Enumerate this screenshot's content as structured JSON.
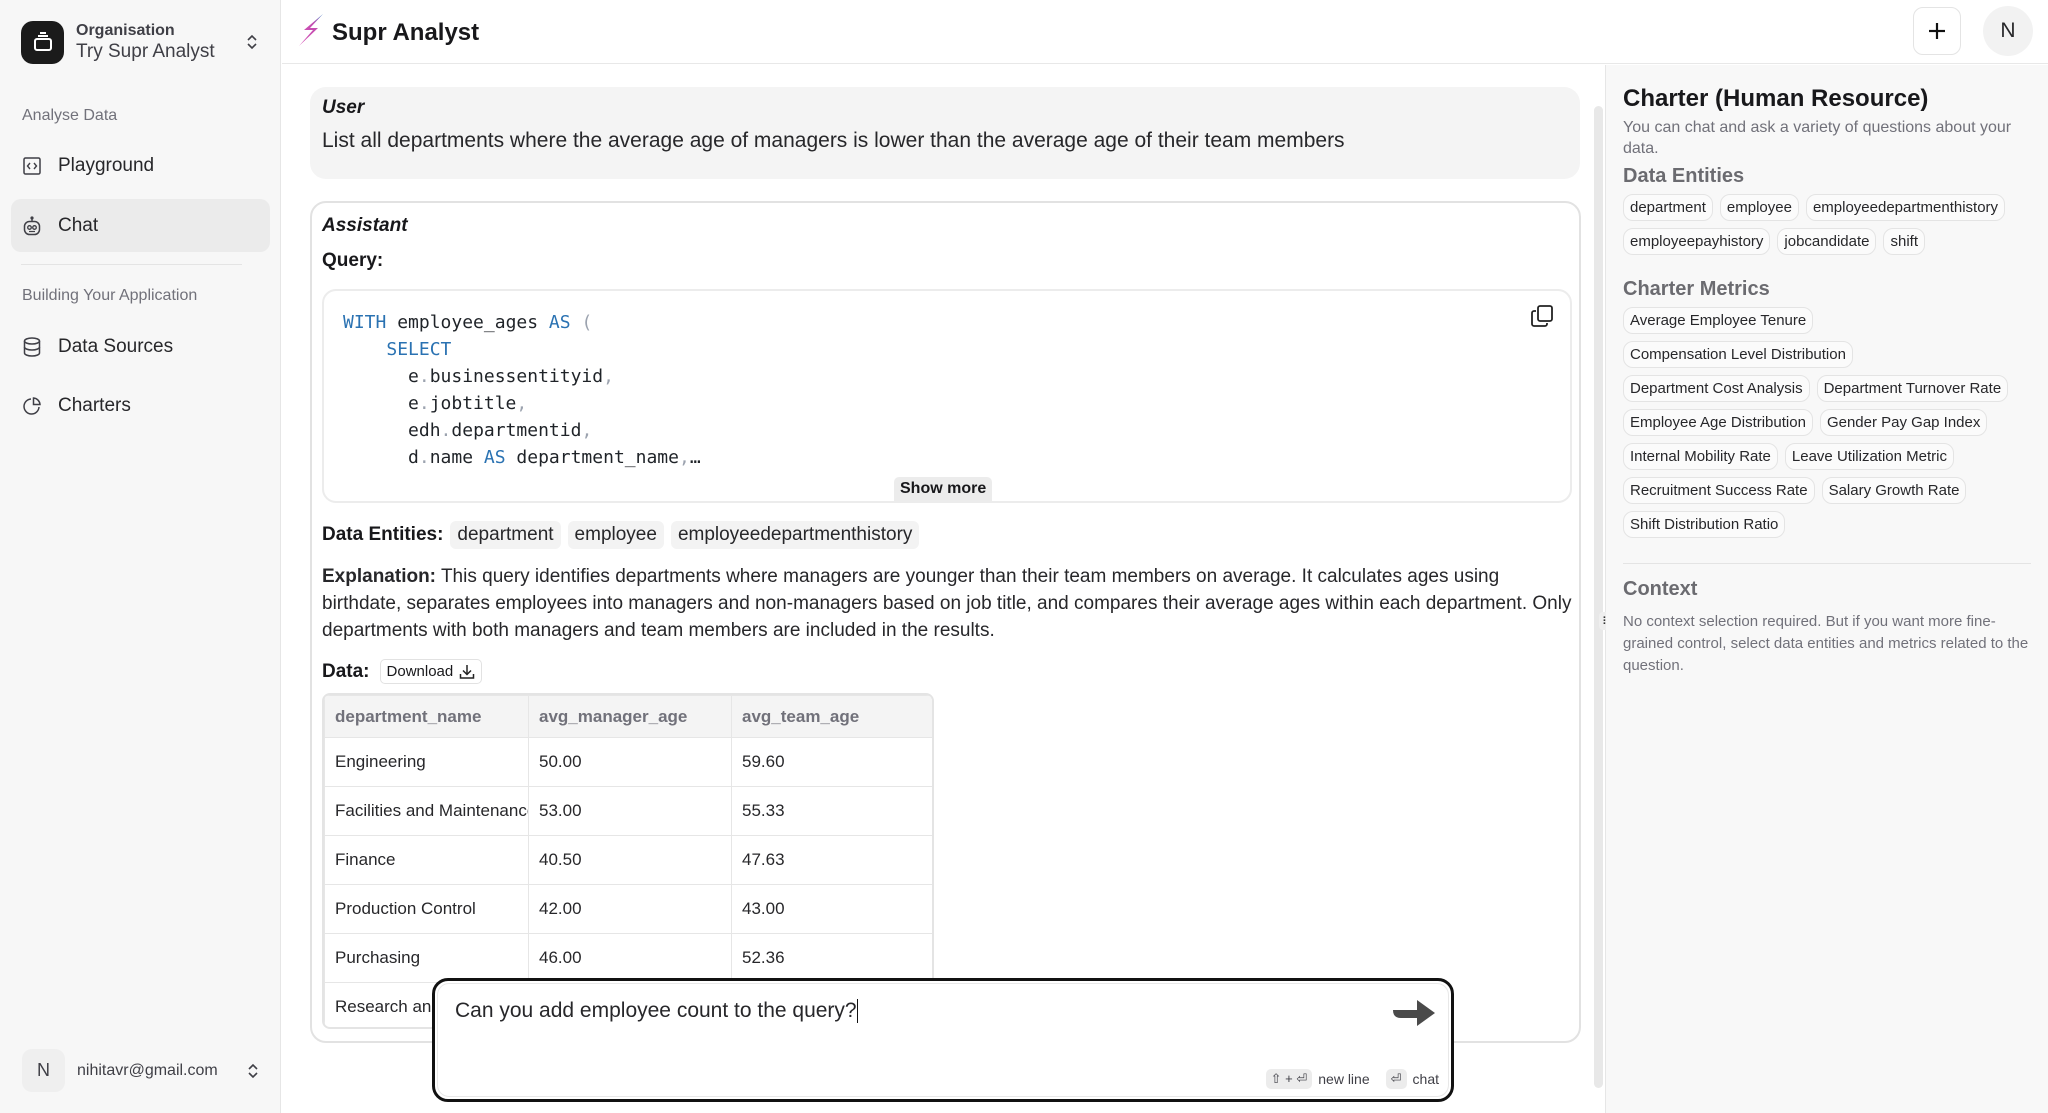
{
  "sidebar": {
    "org_label": "Organisation",
    "org_name": "Try Supr Analyst",
    "section1": "Analyse Data",
    "section2": "Building Your Application",
    "items": [
      {
        "label": "Playground",
        "icon": "code-icon"
      },
      {
        "label": "Chat",
        "icon": "bot-icon",
        "active": true
      },
      {
        "label": "Data Sources",
        "icon": "database-icon"
      },
      {
        "label": "Charters",
        "icon": "pie-chart-icon"
      }
    ],
    "user_initial": "N",
    "user_email": "nihitavr@gmail.com"
  },
  "header": {
    "title": "Supr Analyst",
    "avatar_initial": "N",
    "new_button": "+"
  },
  "chat": {
    "user_role": "User",
    "user_message": "List all departments where the average age of managers is lower than the average age of their team members",
    "assistant_role": "Assistant",
    "query_label": "Query:",
    "show_more": "Show more",
    "entities_label": "Data Entities:",
    "entities": [
      "department",
      "employee",
      "employeedepartmenthistory"
    ],
    "explanation_label": "Explanation:",
    "explanation": " This query identifies departments where managers are younger than their team members on average. It calculates ages using birthdate, separates employees into managers and non-managers based on job title, and compares their average ages within each department. Only departments with both managers and team members are included in the results.",
    "data_label": "Data:",
    "download": "Download",
    "table": {
      "columns": [
        "department_name",
        "avg_manager_age",
        "avg_team_age"
      ],
      "rows": [
        [
          "Engineering",
          "50.00",
          "59.60"
        ],
        [
          "Facilities and Maintenance",
          "53.00",
          "55.33"
        ],
        [
          "Finance",
          "40.50",
          "47.63"
        ],
        [
          "Production Control",
          "42.00",
          "43.00"
        ],
        [
          "Purchasing",
          "46.00",
          "52.36"
        ],
        [
          "Research and Development",
          "",
          ""
        ]
      ]
    }
  },
  "input": {
    "value": "Can you add employee count to the query?",
    "hint_newline_keys": "⇧ + ⏎",
    "hint_newline": "new line",
    "hint_chat_keys": "⏎",
    "hint_chat": "chat"
  },
  "panel": {
    "title": "Charter (Human Resource)",
    "subtitle": "You can chat and ask a variety of questions about your data.",
    "entities_heading": "Data Entities",
    "entities": [
      "department",
      "employee",
      "employeedepartmenthistory",
      "employeepayhistory",
      "jobcandidate",
      "shift"
    ],
    "metrics_heading": "Charter Metrics",
    "metrics": [
      "Average Employee Tenure",
      "Compensation Level Distribution",
      "Department Cost Analysis",
      "Department Turnover Rate",
      "Employee Age Distribution",
      "Gender Pay Gap Index",
      "Internal Mobility Rate",
      "Leave Utilization Metric",
      "Recruitment Success Rate",
      "Salary Growth Rate",
      "Shift Distribution Ratio"
    ],
    "context_heading": "Context",
    "context_text": "No context selection required. But if you want more fine-grained control, select data entities and metrics related to the question."
  }
}
